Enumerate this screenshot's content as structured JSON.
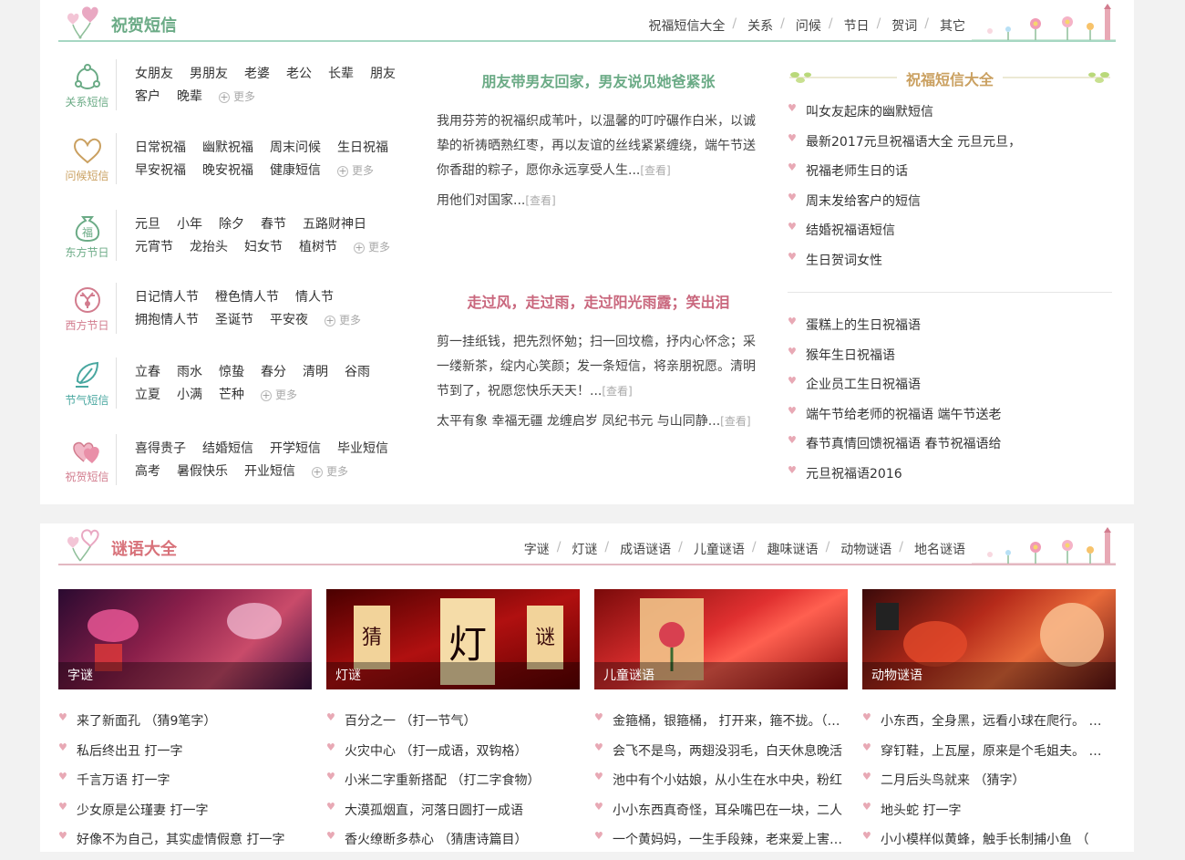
{
  "section1": {
    "title": "祝贺短信",
    "nav": [
      "祝福短信大全",
      "关系",
      "问候",
      "节日",
      "贺词",
      "其它"
    ],
    "categories": [
      {
        "label": "关系短信",
        "color": "#6bab86",
        "rows": [
          [
            "女朋友",
            "男朋友",
            "老婆",
            "老公",
            "长辈",
            "朋友"
          ],
          [
            "客户",
            "晚辈"
          ]
        ]
      },
      {
        "label": "问候短信",
        "color": "#caa060",
        "rows": [
          [
            "日常祝福",
            "幽默祝福",
            "周末问候",
            "生日祝福"
          ],
          [
            "早安祝福",
            "晚安祝福",
            "健康短信"
          ]
        ]
      },
      {
        "label": "东方节日",
        "color": "#6bab86",
        "rows": [
          [
            "元旦",
            "小年",
            "除夕",
            "春节",
            "五路财神日"
          ],
          [
            "元宵节",
            "龙抬头",
            "妇女节",
            "植树节"
          ]
        ]
      },
      {
        "label": "西方节日",
        "color": "#d27c8e",
        "rows": [
          [
            "日记情人节",
            "橙色情人节",
            "情人节"
          ],
          [
            "拥抱情人节",
            "圣诞节",
            "平安夜"
          ]
        ]
      },
      {
        "label": "节气短信",
        "color": "#49a7a0",
        "rows": [
          [
            "立春",
            "雨水",
            "惊蛰",
            "春分",
            "清明",
            "谷雨"
          ],
          [
            "立夏",
            "小满",
            "芒种"
          ]
        ]
      },
      {
        "label": "祝贺短信",
        "color": "#d27c8e",
        "rows": [
          [
            "喜得贵子",
            "结婚短信",
            "开学短信",
            "毕业短信"
          ],
          [
            "高考",
            "暑假快乐",
            "开业短信"
          ]
        ]
      }
    ],
    "more_label": "更多",
    "articles": [
      {
        "title": "朋友带男友回家，男友说见她爸紧张",
        "title_color": "#6bab86",
        "body": "我用芬芳的祝福织成苇叶，以温馨的叮咛碾作白米，以诚挚的祈祷晒熟红枣，再以友谊的丝线紧紧缠绕，端午节送你香甜的粽子，愿你永远享受人生...",
        "extra": "用他们对国家..."
      },
      {
        "title": "走过风，走过雨，走过阳光雨露；笑出泪",
        "title_color": "#c9677d",
        "body": "剪一挂纸钱，把先烈怀勉；扫一回坟檐，抒内心怀念；采一缕新茶，绽内心笑颜；发一条短信，将亲朋祝愿。清明节到了，祝愿您快乐天天！...",
        "extra": "太平有象 幸福无疆 龙缠启岁 凤纪书元 与山同静..."
      }
    ],
    "view_label": "[查看]",
    "right_title": "祝福短信大全",
    "right_list_a": [
      "叫女友起床的幽默短信",
      "最新2017元旦祝福语大全 元旦元旦，",
      "祝福老师生日的话",
      "周末发给客户的短信",
      "结婚祝福语短信",
      "生日贺词女性"
    ],
    "right_list_b": [
      "蛋糕上的生日祝福语",
      "猴年生日祝福语",
      "企业员工生日祝福语",
      "端午节给老师的祝福语 端午节送老",
      "春节真情回馈祝福语 春节祝福语给",
      "元旦祝福语2016"
    ]
  },
  "section2": {
    "title": "谜语大全",
    "nav": [
      "字谜",
      "灯谜",
      "成语谜语",
      "儿童谜语",
      "趣味谜语",
      "动物谜语",
      "地名谜语"
    ],
    "pictures": [
      {
        "caption": "字谜",
        "bg": "#7a1f3d"
      },
      {
        "caption": "灯谜",
        "bg": "#8a0f0f"
      },
      {
        "caption": "儿童谜语",
        "bg": "#a01414"
      },
      {
        "caption": "动物谜语",
        "bg": "#7d2a1a"
      }
    ],
    "lists": [
      [
        "来了新面孔 （猜9笔字）",
        "私后终出丑 打一字",
        "千言万语 打一字",
        "少女原是公瑾妻 打一字",
        "好像不为自己，其实虚情假意 打一字"
      ],
      [
        "百分之一 （打一节气）",
        "火灾中心 （打一成语，双钩格）",
        "小米二字重新搭配 （打二字食物）",
        "大漠孤烟直，河落日圆打一成语",
        "香火缭断多恭心 （猜唐诗篇目）"
      ],
      [
        "金箍桶，银箍桶， 打开来，箍不拢。（…",
        "会飞不是鸟，两翅没羽毛，白天休息晚活",
        "池中有个小姑娘，从小生在水中央，粉红",
        "小小东西真奇怪，耳朵嘴巴在一块，二人",
        "一个黄妈妈，一生手段辣，老来爱上害…"
      ],
      [
        "小东西，全身黑，远看小球在爬行。 …",
        "穿钉鞋，上瓦屋，原来是个毛姐夫。 …",
        "二月后头鸟就来 （猜字）",
        "地头蛇 打一字",
        "小小模样似黄蜂，触手长制捕小鱼 （"
      ]
    ]
  }
}
